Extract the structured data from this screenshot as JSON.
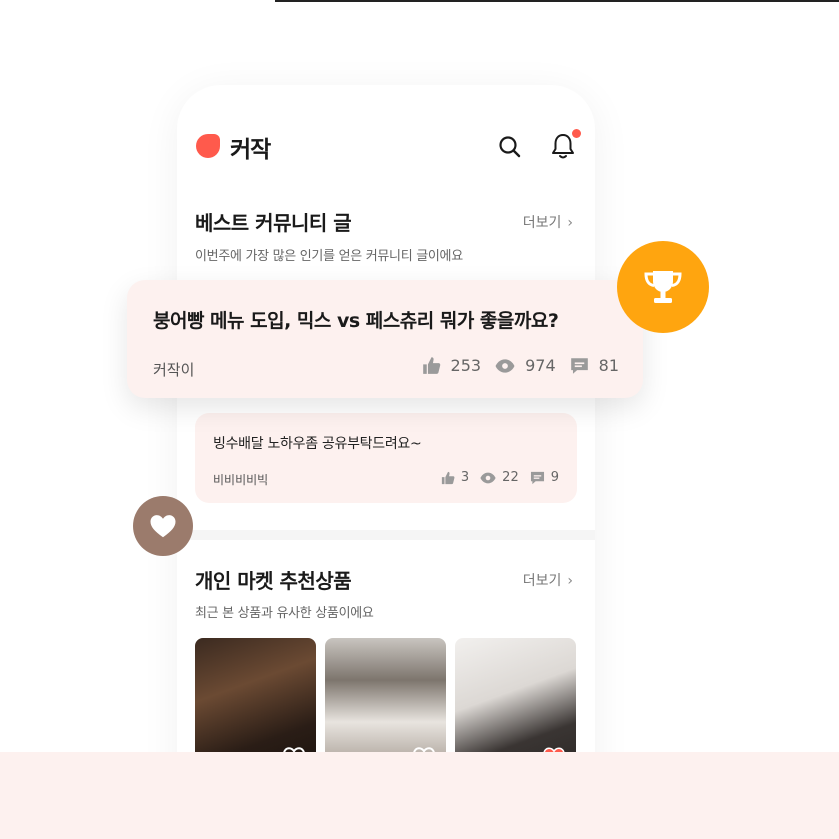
{
  "header": {
    "logo_text": "커작"
  },
  "best_section": {
    "title": "베스트 커뮤니티 글",
    "subtitle": "이번주에 가장 많은 인기를 얻은 커뮤니티 글이에요",
    "more_label": "더보기"
  },
  "featured_post": {
    "title": "붕어빵 메뉴 도입, 믹스 vs 페스츄리 뭐가 좋을까요?",
    "author": "커작이",
    "likes": "253",
    "views": "974",
    "comments": "81"
  },
  "second_post": {
    "title": "빙수배달 노하우좀 공유부탁드려요~",
    "author": "비비비비빅",
    "likes": "3",
    "views": "22",
    "comments": "9"
  },
  "market_section": {
    "title": "개인 마켓 추천상품",
    "subtitle": "최근 본 상품과 유사한 상품이에요",
    "more_label": "더보기"
  },
  "products": [
    {
      "icon": "heart-outline-icon",
      "favorited": false
    },
    {
      "icon": "heart-outline-icon",
      "favorited": false
    },
    {
      "icon": "heart-filled-icon",
      "favorited": true
    }
  ],
  "colors": {
    "brand": "#ff5a4c",
    "card_bg": "#fdf1ef",
    "trophy_badge": "#ffa50f",
    "heart_badge": "#9b7b6c"
  }
}
